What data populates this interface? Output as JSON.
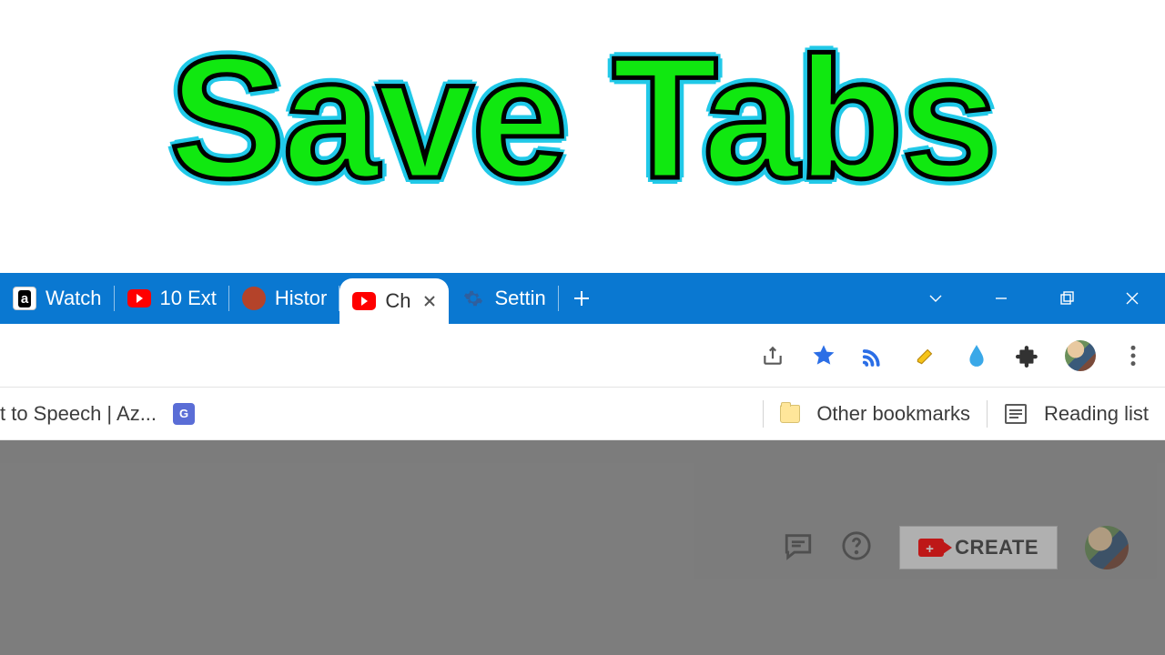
{
  "hero": {
    "title": "Save Tabs"
  },
  "tabs": [
    {
      "favicon": "amazon",
      "label": "Watch",
      "active": false
    },
    {
      "favicon": "youtube",
      "label": "10 Ext",
      "active": false
    },
    {
      "favicon": "badge",
      "label": "Histor",
      "active": false
    },
    {
      "favicon": "youtube",
      "label": "Ch",
      "active": true
    },
    {
      "favicon": "gear",
      "label": "Settin",
      "active": false
    }
  ],
  "window_controls": {
    "tabs_dropdown": "chevron-down",
    "minimize": "minimize",
    "maximize": "maximize",
    "close": "close"
  },
  "toolbar": {
    "icons": [
      "share-icon",
      "star-icon",
      "cast-icon",
      "highlight-icon",
      "drop-icon",
      "extensions-icon",
      "avatar",
      "menu-icon"
    ]
  },
  "bookmarks": {
    "left_truncated": "t to Speech |  Az...",
    "other_label": "Other bookmarks",
    "reading_label": "Reading list"
  },
  "page": {
    "create_label": "CREATE"
  }
}
